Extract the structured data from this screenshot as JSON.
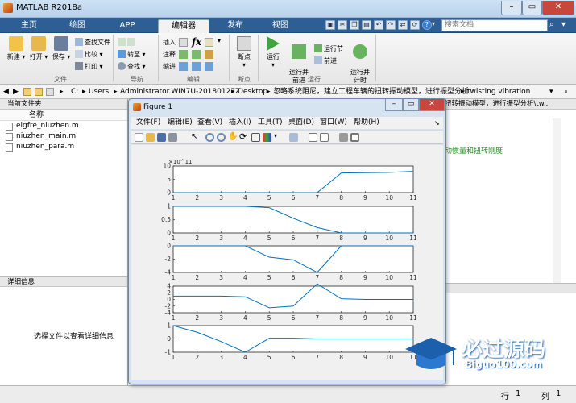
{
  "window": {
    "title": "MATLAB R2018a"
  },
  "tabs": [
    "主页",
    "绘图",
    "APP",
    "编辑器",
    "发布",
    "视图"
  ],
  "search": {
    "placeholder": "搜索文档"
  },
  "ribbon": {
    "file_group": {
      "label": "文件",
      "new": "新建",
      "open": "打开",
      "save": "保存",
      "find_files": "查找文件",
      "compare": "比较",
      "print": "打印"
    },
    "nav_group": {
      "label": "导航",
      "goto": "转至",
      "find": "查找"
    },
    "edit_group": {
      "label": "编辑",
      "insert": "插入",
      "comment": "注释",
      "indent": "缩进",
      "fx": "fx"
    },
    "breakpoint_group": {
      "label": "断点",
      "breakpoints": "断点"
    },
    "run_group": {
      "label": "运行",
      "run": "运行",
      "run_advance": "运行并\n前进",
      "run_section": "运行节",
      "advance": "前进",
      "run_time": "运行并\n计时"
    }
  },
  "address": {
    "parts": [
      "C:",
      "Users",
      "Administrator.WIN7U-20180127Z",
      "Desktop",
      "忽略系统阻尼，建立工程车辆的扭转振动模型，进行振型分析",
      "twisting vibration"
    ]
  },
  "current_folder": {
    "title": "当前文件夹",
    "column": "名称",
    "files": [
      "eigfre_niuzhen.m",
      "niuzhen_main.m",
      "niuzhen_para.m"
    ]
  },
  "details": {
    "title": "详细信息",
    "hint": "选择文件以查看详细信息"
  },
  "editor_right": {
    "tab_text": "扭转振动模型，进行振型分析\\tw...",
    "code_comment": "动惯量和扭转刚度"
  },
  "status": {
    "row": "行",
    "row_value": "1",
    "col": "列",
    "col_value": "1"
  },
  "figure": {
    "title": "Figure 1",
    "menu": [
      "文件(F)",
      "编辑(E)",
      "查看(V)",
      "插入(I)",
      "工具(T)",
      "桌面(D)",
      "窗口(W)",
      "帮助(H)"
    ]
  },
  "logo": {
    "cn": "必过源码",
    "en": "Biguo100.com"
  },
  "chart_data": [
    {
      "type": "line",
      "x": [
        1,
        2,
        3,
        4,
        5,
        6,
        7,
        8,
        9,
        10,
        11
      ],
      "y": [
        0,
        0,
        0,
        0,
        0,
        0,
        0,
        7.4,
        7.5,
        7.6,
        8.0
      ],
      "ylim": [
        0,
        10
      ],
      "yticks": [
        0,
        5,
        10
      ],
      "exponent": "×10^11",
      "xticks": [
        1,
        2,
        3,
        4,
        5,
        6,
        7,
        8,
        9,
        10,
        11
      ]
    },
    {
      "type": "line",
      "x": [
        1,
        2,
        3,
        4,
        5,
        6,
        7,
        8,
        9,
        10,
        11
      ],
      "y": [
        1,
        1,
        1,
        1,
        0.95,
        0.55,
        0.2,
        0,
        0,
        0,
        0
      ],
      "ylim": [
        0,
        1
      ],
      "yticks": [
        0,
        0.5,
        1
      ],
      "xticks": [
        1,
        2,
        3,
        4,
        5,
        6,
        7,
        8,
        9,
        10,
        11
      ]
    },
    {
      "type": "line",
      "x": [
        1,
        2,
        3,
        4,
        5,
        6,
        7,
        8,
        9,
        10,
        11
      ],
      "y": [
        0,
        0,
        0,
        0,
        -1.7,
        -2.1,
        -4,
        0,
        0,
        0,
        0
      ],
      "ylim": [
        -4,
        0
      ],
      "yticks": [
        -4,
        -2,
        0
      ],
      "xticks": [
        1,
        2,
        3,
        4,
        5,
        6,
        7,
        8,
        9,
        10,
        11
      ]
    },
    {
      "type": "line",
      "x": [
        1,
        2,
        3,
        4,
        5,
        6,
        7,
        8,
        9,
        10,
        11
      ],
      "y": [
        1,
        1,
        1,
        0.8,
        -2.5,
        -2,
        4.7,
        0.2,
        0,
        0,
        0
      ],
      "ylim": [
        -4,
        4
      ],
      "yticks": [
        -4,
        -2,
        0,
        2,
        4
      ],
      "xticks": [
        1,
        2,
        3,
        4,
        5,
        6,
        7,
        8,
        9,
        10,
        11
      ]
    },
    {
      "type": "line",
      "x": [
        1,
        2,
        3,
        4,
        5,
        6,
        7,
        8,
        9,
        10,
        11
      ],
      "y": [
        1,
        0.5,
        -0.2,
        -1,
        0.05,
        0.05,
        0,
        0,
        0,
        0,
        0
      ],
      "ylim": [
        -1,
        1
      ],
      "yticks": [
        -1,
        0,
        1
      ],
      "xticks": [
        1,
        2,
        3,
        4,
        5,
        6,
        7,
        8,
        9,
        10,
        11
      ]
    }
  ]
}
